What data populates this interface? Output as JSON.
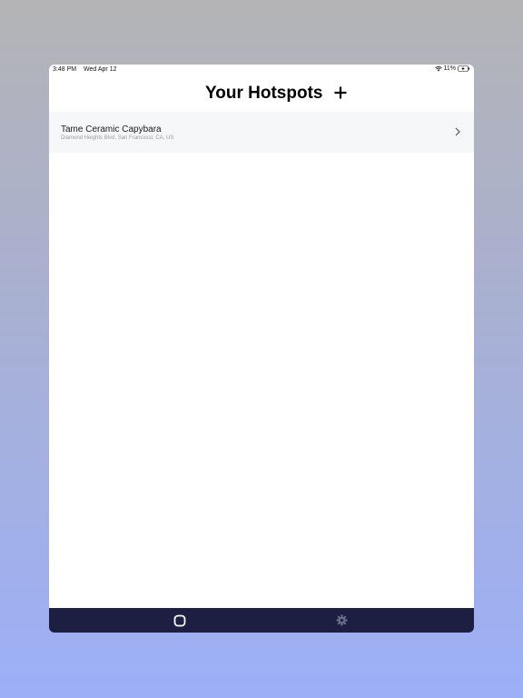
{
  "status_bar": {
    "time": "3:48 PM",
    "date": "Wed Apr 12",
    "battery_percent": "11%"
  },
  "header": {
    "title": "Your Hotspots",
    "add_icon": "plus-icon"
  },
  "hotspots": [
    {
      "name": "Tame Ceramic Capybara",
      "address": "Diamond Heights Blvd, San Francisco, CA, US"
    }
  ],
  "tab_bar": {
    "background": "#1c1f42",
    "tabs": [
      {
        "icon": "home-square-icon",
        "active": true
      },
      {
        "icon": "gear-icon",
        "active": false
      }
    ]
  }
}
